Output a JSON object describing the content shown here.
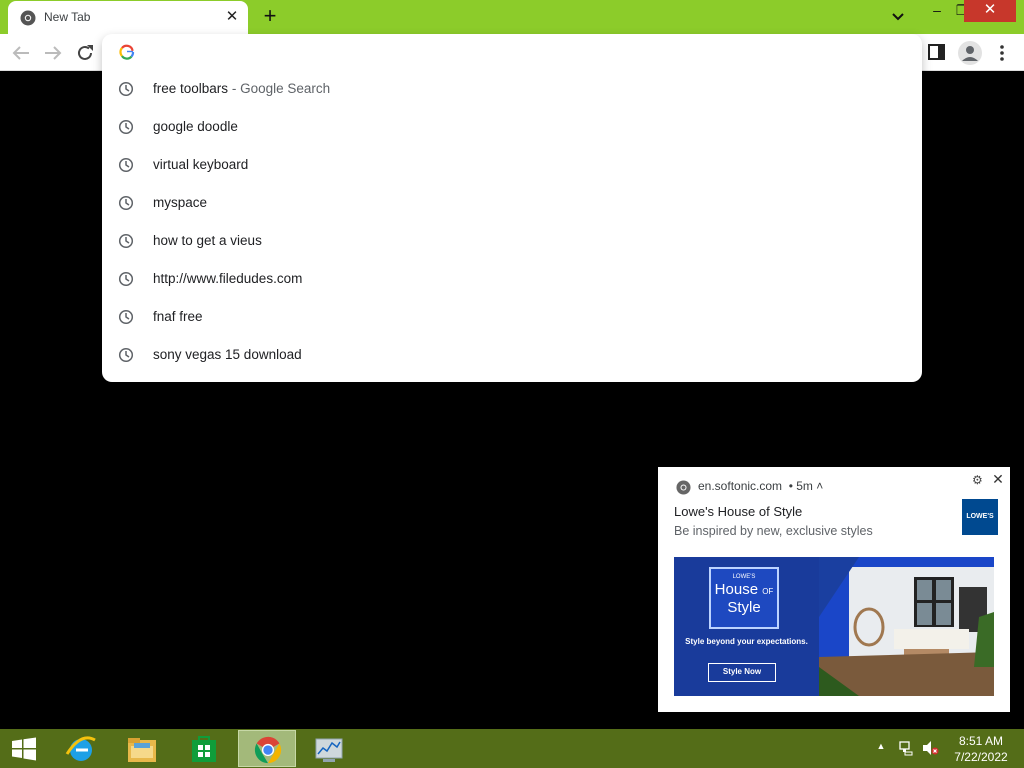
{
  "browser": {
    "tab_title": "New Tab",
    "tab_icon": "chrome-icon"
  },
  "omnibox": {
    "value": "",
    "suggestions": [
      {
        "text": "free toolbars",
        "separator": "-",
        "sub": "Google Search"
      },
      {
        "text": "google doodle"
      },
      {
        "text": "virtual keyboard"
      },
      {
        "text": "myspace"
      },
      {
        "text": "how to get a vieus"
      },
      {
        "text": "http://www.filedudes.com"
      },
      {
        "text": "fnaf free"
      },
      {
        "text": "sony vegas 15 download"
      }
    ]
  },
  "notification": {
    "source": "en.softonic.com",
    "time": "• 5m",
    "title": "Lowe's House of Style",
    "body": "Be inspired by new, exclusive styles",
    "logo_text": "LOWE'S",
    "ad": {
      "badge_top": "LOWE'S",
      "house": "House",
      "of": "OF",
      "style": "Style",
      "tagline": "Style beyond your expectations.",
      "cta": "Style Now"
    }
  },
  "taskbar": {
    "apps": [
      "windows-start",
      "internet-explorer",
      "file-explorer",
      "store",
      "chrome",
      "resource-monitor"
    ],
    "time": "8:51 AM",
    "date": "7/22/2022"
  },
  "colors": {
    "titlebar": "#8ccc2a",
    "taskbar": "#546d18",
    "close_button": "#c7372b",
    "ad_blue": "#193b9b"
  }
}
